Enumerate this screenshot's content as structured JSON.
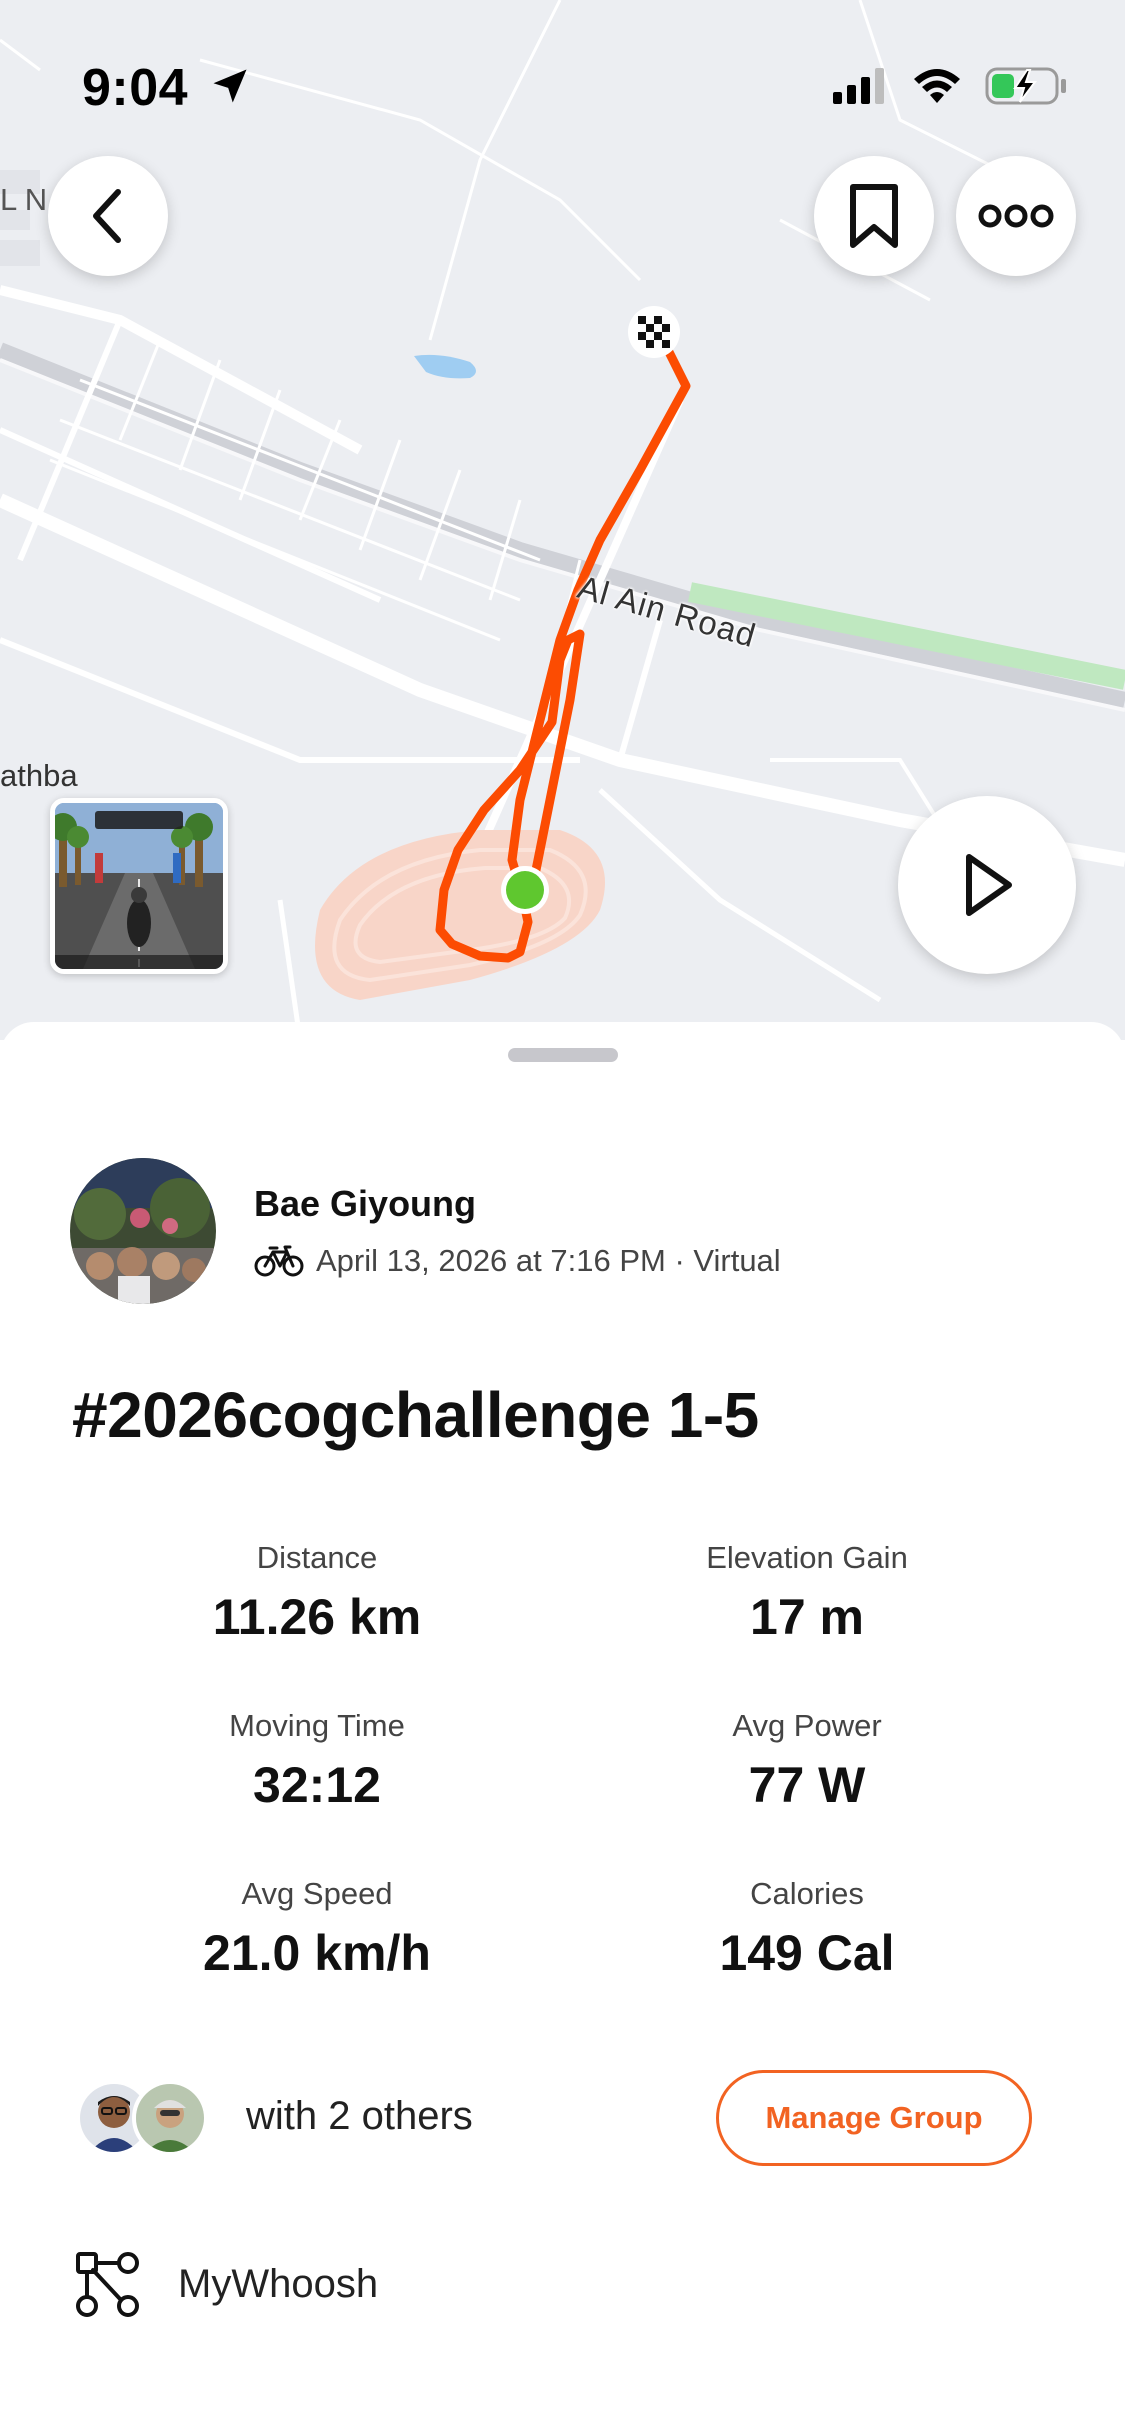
{
  "status_bar": {
    "time": "9:04"
  },
  "map": {
    "labels": {
      "left_fragment_top": "L N",
      "left_fragment_bottom": "athba",
      "road": "Al Ain Road"
    },
    "route_color": "#fc4c02",
    "start_marker_color": "#5fc72f"
  },
  "header_buttons": {
    "back": "back-icon",
    "bookmark": "bookmark-icon",
    "more": "more-icon",
    "play": "play-icon"
  },
  "athlete": {
    "name": "Bae Giyoung",
    "date_line": "April 13, 2026 at 7:16 PM · Virtual",
    "activity_icon": "bike-icon"
  },
  "activity": {
    "title": "#2026cogchallenge 1-5"
  },
  "stats": [
    {
      "label": "Distance",
      "value": "11.26 km"
    },
    {
      "label": "Elevation Gain",
      "value": "17 m"
    },
    {
      "label": "Moving Time",
      "value": "32:12"
    },
    {
      "label": "Avg Power",
      "value": "77 W"
    },
    {
      "label": "Avg Speed",
      "value": "21.0 km/h"
    },
    {
      "label": "Calories",
      "value": "149 Cal"
    }
  ],
  "group": {
    "text": "with 2 others",
    "button_label": "Manage Group"
  },
  "device": {
    "name": "MyWhoosh",
    "icon": "device-icon"
  },
  "colors": {
    "accent": "#f26322",
    "route": "#fc4c02"
  }
}
